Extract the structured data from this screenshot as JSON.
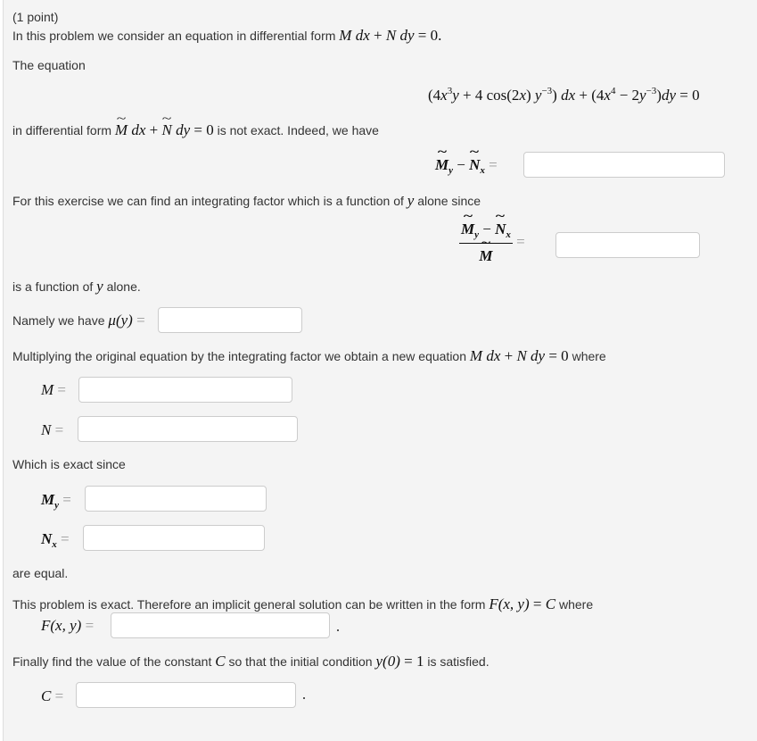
{
  "header": {
    "points": "(1 point)"
  },
  "intro": {
    "text": "In this problem we consider an equation in differential form",
    "eq_M": "M",
    "eq_dx": "dx",
    "eq_plus": "+",
    "eq_N": "N",
    "eq_dy": "dy",
    "eq_equals": "= 0."
  },
  "equation_label": "The equation",
  "equation": {
    "open": "(4",
    "x": "x",
    "exp3": "3",
    "y1": "y",
    "plus4cos": " + 4 cos(2",
    "x2": "x",
    "close_paren": ")",
    "y2": "y",
    "exp_neg3": "−3",
    "close": ")",
    "dx": "dx",
    "plus": " + (4",
    "x3": "x",
    "exp4": "4",
    "minus2": " − 2",
    "y3": "y",
    "exp_neg3b": "−3",
    "close2": ")",
    "dy": "dy",
    "equals0": " = 0"
  },
  "not_exact": {
    "prefix": "in differential form",
    "M": "M",
    "dx": "dx",
    "plus": "+",
    "N": "N",
    "dy": "dy",
    "equals0": "= 0",
    "suffix": "is not exact. Indeed, we have"
  },
  "diff_label": {
    "M": "M",
    "y": "y",
    "minus": "−",
    "N": "N",
    "x": "x",
    "equals": "="
  },
  "integrating_text": {
    "prefix": "For this exercise we can find an integrating factor which is a function of",
    "var": "y",
    "suffix": "alone since"
  },
  "ratio_label": {
    "M": "M",
    "y": "y",
    "minus": "−",
    "N": "N",
    "x": "x",
    "den": "M",
    "equals": "="
  },
  "function_of_y": {
    "prefix": "is a function of",
    "var": "y",
    "suffix": "alone."
  },
  "mu_row": {
    "prefix": "Namely we have",
    "mu": "μ",
    "arg": "(y)",
    "equals": "="
  },
  "multiply_text": {
    "prefix": "Multiplying the original equation by the integrating factor we obtain a new equation",
    "M": "M",
    "dx": "dx",
    "plus": "+",
    "N": "N",
    "dy": "dy",
    "equals0": "= 0",
    "suffix": "where"
  },
  "M_row": {
    "label": "M",
    "equals": "="
  },
  "N_row": {
    "label": "N",
    "equals": "="
  },
  "exact_since": "Which is exact since",
  "My_row": {
    "label": "M",
    "sub": "y",
    "equals": "="
  },
  "Nx_row": {
    "label": "N",
    "sub": "x",
    "equals": "="
  },
  "are_equal": "are equal.",
  "implicit_text": {
    "prefix": "This problem is exact. Therefore an implicit general solution can be written in the form",
    "F": "F",
    "args": "(x, y)",
    "equals": "=",
    "C": "C",
    "suffix": "where"
  },
  "F_row": {
    "label": "F",
    "args": "(x, y)",
    "equals": "="
  },
  "final_text": {
    "prefix": "Finally find the value of the constant",
    "C": "C",
    "middle": "so that the initial condition",
    "cond": "y(0)",
    "equals": "=",
    "one": "1",
    "suffix": "is satisfied."
  },
  "C_row": {
    "label": "C",
    "equals": "="
  },
  "inputs": {
    "diff": "",
    "ratio": "",
    "mu": "",
    "M": "",
    "N": "",
    "My": "",
    "Nx": "",
    "F": "",
    "C": ""
  }
}
